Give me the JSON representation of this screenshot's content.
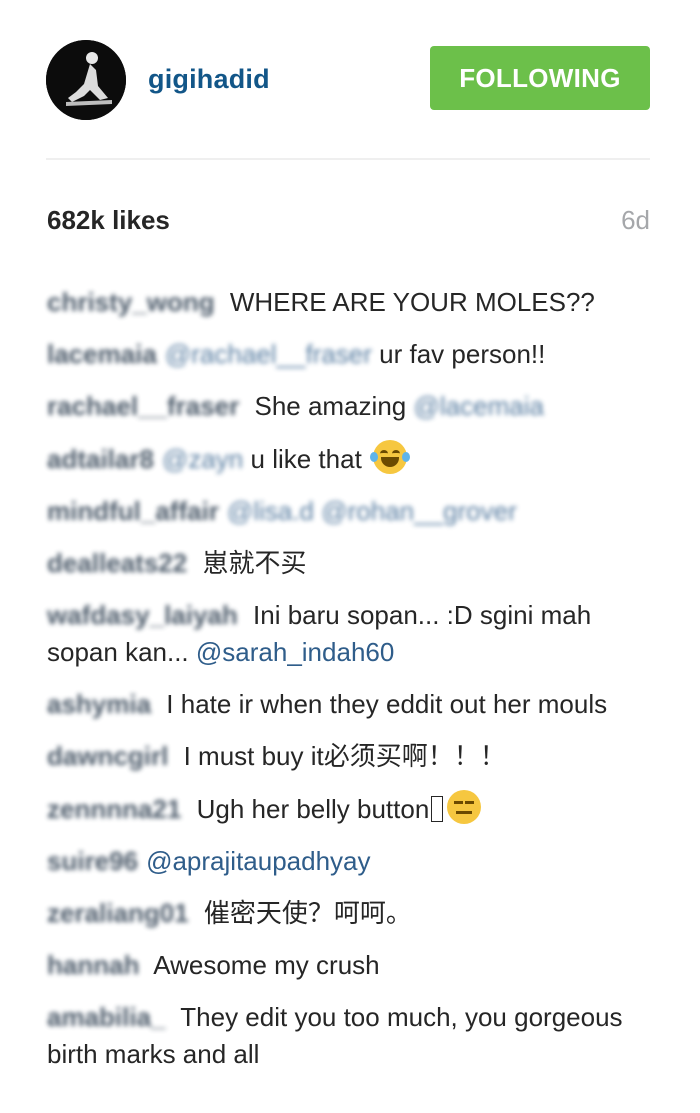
{
  "post": {
    "username": "gigihadid",
    "follow_label": "FOLLOWING",
    "likes": "682k likes",
    "age": "6d"
  },
  "comments": [
    {
      "author": "christy_wong",
      "text": " WHERE ARE YOUR MOLES??"
    },
    {
      "author": "lacemaia",
      "mention": "@rachael__fraser",
      "text": " ur fav person!!"
    },
    {
      "author": "rachael__fraser",
      "text": " She amazing ",
      "mention_after": "@lacemaia"
    },
    {
      "author": "adtailar8",
      "mention": "@zayn",
      "text": " u like that ",
      "emoji": "face-with-tears-of-joy-icon"
    },
    {
      "author": "mindful_affair",
      "mention": "@lisa.d @rohan__grover"
    },
    {
      "author": "dealleats22",
      "text": " 崽就不买"
    },
    {
      "author": "wafdasy_laiyah",
      "text": " Ini baru sopan... :D sgini mah sopan kan... ",
      "mention_after": "@sarah_indah60"
    },
    {
      "author": "ashymia",
      "text": " I hate ir when they eddit out her mouls"
    },
    {
      "author": "dawncgirl",
      "text": " I must buy it必须买啊！！！"
    },
    {
      "author": "zennnna21",
      "text": " Ugh her belly button",
      "emoji": "neutral-face-icon"
    },
    {
      "author": "suire96",
      "mention": "@aprajitaupadhyay"
    },
    {
      "author": "zeraliang01",
      "text": " 催密天使？呵呵。"
    },
    {
      "author": "hannah",
      "text": " Awesome my crush"
    },
    {
      "author": "amabilia_",
      "text": " They edit you too much, you gorgeous birth marks and all"
    }
  ]
}
